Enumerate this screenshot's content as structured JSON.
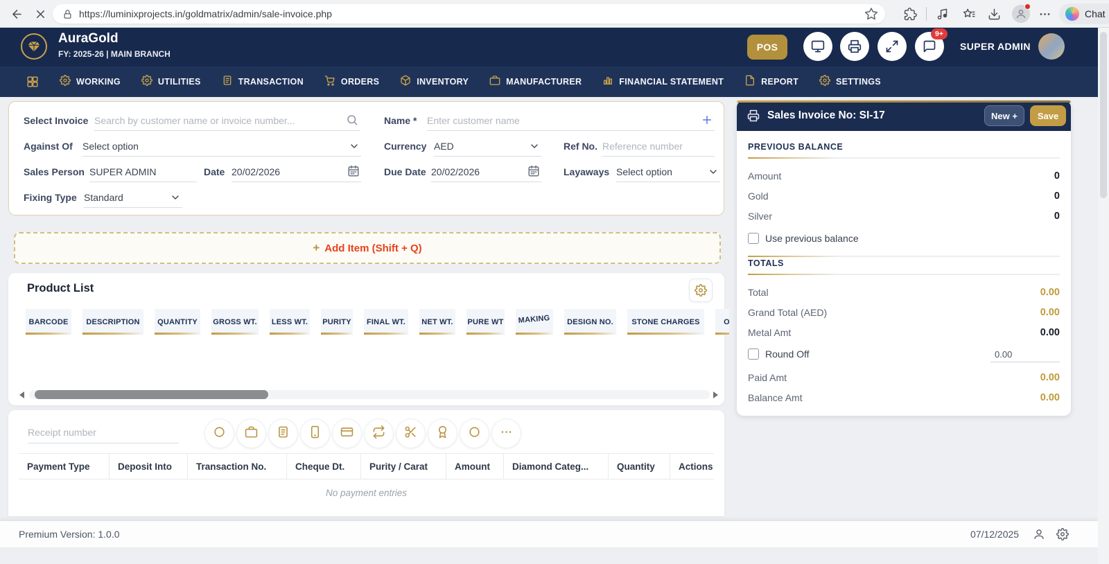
{
  "browser": {
    "url": "https://luminixprojects.in/goldmatrix/admin/sale-invoice.php",
    "copilot_label": "Chat"
  },
  "header": {
    "app_name": "AuraGold",
    "subtitle": "FY: 2025-26 | MAIN BRANCH",
    "pos_label": "POS",
    "notification_badge": "9+",
    "user_name": "SUPER ADMIN"
  },
  "nav": {
    "items": [
      {
        "label": "WORKING",
        "icon": "gear"
      },
      {
        "label": "UTILITIES",
        "icon": "gear"
      },
      {
        "label": "TRANSACTION",
        "icon": "document"
      },
      {
        "label": "ORDERS",
        "icon": "cart"
      },
      {
        "label": "INVENTORY",
        "icon": "box"
      },
      {
        "label": "MANUFACTURER",
        "icon": "briefcase"
      },
      {
        "label": "FINANCIAL STATEMENT",
        "icon": "chart"
      },
      {
        "label": "REPORT",
        "icon": "file"
      },
      {
        "label": "SETTINGS",
        "icon": "gear"
      }
    ]
  },
  "form": {
    "select_invoice": {
      "label": "Select Invoice",
      "placeholder": "Search by customer name or invoice number..."
    },
    "name": {
      "label": "Name *",
      "placeholder": "Enter customer name"
    },
    "against_of": {
      "label": "Against Of",
      "value": "Select option"
    },
    "currency": {
      "label": "Currency",
      "value": "AED"
    },
    "ref_no": {
      "label": "Ref No.",
      "placeholder": "Reference number"
    },
    "sales_person": {
      "label": "Sales Person",
      "value": "SUPER ADMIN"
    },
    "date": {
      "label": "Date",
      "value": "20/02/2026"
    },
    "due_date": {
      "label": "Due Date",
      "value": "20/02/2026"
    },
    "layaways": {
      "label": "Layaways",
      "value": "Select option"
    },
    "fixing_type": {
      "label": "Fixing Type",
      "value": "Standard"
    }
  },
  "add_item": {
    "plus": "+",
    "label": "Add Item (Shift + Q)"
  },
  "product_list": {
    "title": "Product List",
    "columns": [
      "BARCODE",
      "DESCRIPTION",
      "QUANTITY",
      "GROSS WT.",
      "LESS WT.",
      "PURITY",
      "FINAL WT.",
      "NET WT.",
      "PURE WT",
      "MAKING",
      "DESIGN NO.",
      "STONE CHARGES",
      "OT"
    ]
  },
  "payments": {
    "receipt_placeholder": "Receipt number",
    "method_icons": [
      "coin-circle",
      "briefcase",
      "cheque-note",
      "mobile",
      "card",
      "exchange",
      "scissors",
      "award",
      "token-circle",
      "more"
    ],
    "columns": [
      "Payment Type",
      "Deposit Into",
      "Transaction No.",
      "Cheque Dt.",
      "Purity / Carat",
      "Amount",
      "Diamond Categ...",
      "Quantity",
      "Actions"
    ],
    "empty_text": "No payment entries"
  },
  "invoice_panel": {
    "title": "Sales Invoice No: SI-17",
    "new_label": "New +",
    "save_label": "Save",
    "previous_balance": {
      "heading": "PREVIOUS BALANCE",
      "rows": [
        {
          "label": "Amount",
          "value": "0"
        },
        {
          "label": "Gold",
          "value": "0"
        },
        {
          "label": "Silver",
          "value": "0"
        }
      ],
      "checkbox_label": "Use previous balance"
    },
    "totals": {
      "heading": "TOTALS",
      "rows": [
        {
          "label": "Total",
          "value": "0.00",
          "style": "gold"
        },
        {
          "label": "Grand Total (AED)",
          "value": "0.00",
          "style": "gold"
        },
        {
          "label": "Metal Amt",
          "value": "0.00",
          "style": "dark"
        },
        {
          "label": "Round Off",
          "value": "0.00",
          "style": "roundoff"
        },
        {
          "label": "Paid Amt",
          "value": "0.00",
          "style": "gold"
        },
        {
          "label": "Balance Amt",
          "value": "0.00",
          "style": "gold"
        }
      ]
    }
  },
  "footer": {
    "version": "Premium Version: 1.0.0",
    "date": "07/12/2025"
  },
  "colors": {
    "navy": "#18294e",
    "nav_navy": "#1f3359",
    "gold": "#c09b3c",
    "accent_red": "#e8421f"
  }
}
